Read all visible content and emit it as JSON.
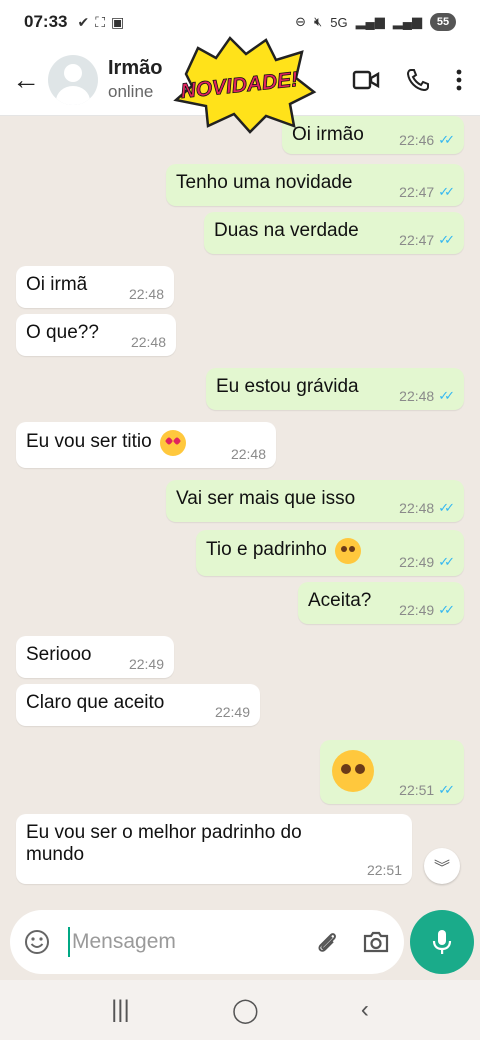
{
  "status_bar": {
    "time": "07:33",
    "network": "5G",
    "battery": "55"
  },
  "header": {
    "contact_name": "Irmão",
    "contact_status": "online"
  },
  "sticker": {
    "text": "NOVIDADE!"
  },
  "messages": [
    {
      "text": "Oi irmão",
      "time": "22:46",
      "dir": "out",
      "read": true
    },
    {
      "text": "Tenho uma novidade",
      "time": "22:47",
      "dir": "out",
      "read": true
    },
    {
      "text": "Duas na verdade",
      "time": "22:47",
      "dir": "out",
      "read": true
    },
    {
      "text": "Oi irmã",
      "time": "22:48",
      "dir": "in"
    },
    {
      "text": "O que??",
      "time": "22:48",
      "dir": "in"
    },
    {
      "text": "Eu estou grávida",
      "time": "22:48",
      "dir": "out",
      "read": true
    },
    {
      "text": "Eu vou ser titio",
      "emoji": "heart-eyes-emoji",
      "time": "22:48",
      "dir": "in"
    },
    {
      "text": "Vai ser mais que isso",
      "time": "22:48",
      "dir": "out",
      "read": true
    },
    {
      "text": "Tio e padrinho",
      "emoji": "hand-over-mouth-emoji",
      "time": "22:49",
      "dir": "out",
      "read": true
    },
    {
      "text": "Aceita?",
      "time": "22:49",
      "dir": "out",
      "read": true
    },
    {
      "text": "Seriooo",
      "time": "22:49",
      "dir": "in"
    },
    {
      "text": "Claro que aceito",
      "time": "22:49",
      "dir": "in"
    },
    {
      "text": "",
      "emoji": "pleading-face-emoji",
      "time": "22:51",
      "dir": "out",
      "read": true
    },
    {
      "text": "Eu vou ser o melhor padrinho do mundo",
      "line1": "Eu vou ser o melhor padrinho do",
      "line2": "mundo",
      "time": "22:51",
      "dir": "in"
    }
  ],
  "composer": {
    "placeholder": "Mensagem"
  },
  "colors": {
    "outgoing_bubble": "#e3f7d0",
    "incoming_bubble": "#ffffff",
    "accent": "#1aab8a",
    "read_ticks": "#34b7f1",
    "chat_bg": "#efe9e3"
  }
}
